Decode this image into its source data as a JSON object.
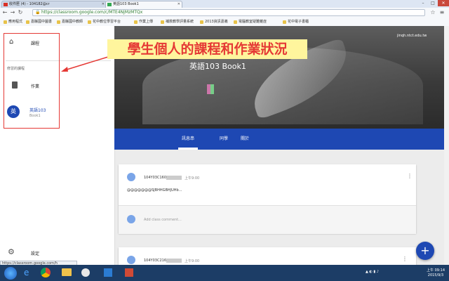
{
  "browser": {
    "tabs": [
      {
        "label": "收件匣 (4) - 104182@cr"
      },
      {
        "label": "英語103 Book1"
      }
    ],
    "url": "https://classroom.google.com/c/MTE4NjMzMTQx",
    "bookmarks": [
      "應用程式",
      "嘉縣國中圖書",
      "嘉縣國中教師",
      "花中教位學習平台",
      "作業上傳",
      "補救教學評量系統",
      "2013資訊嘉義",
      "電腦教室疑難雜症",
      "花中電子書櫃"
    ],
    "status_url": "https://classroom.google.com/h"
  },
  "sidebar": {
    "classes_label": "課程",
    "section_label": "修習的課程",
    "todo_label": "作業",
    "course": {
      "avatar": "英",
      "name": "英語103",
      "section": "Book1"
    },
    "settings_label": "設定"
  },
  "account": {
    "email": "jinqh.ntct.edu.tw"
  },
  "banner": {
    "title": "英語103 Book1"
  },
  "course_tabs": [
    "訊息串",
    "同學",
    "關於"
  ],
  "annotation": "學生個人的課程和作業狀況",
  "posts": [
    {
      "author": "104Y03C160",
      "time": "上午9:00",
      "body": "@@@@@@@SJBHHGBHJUHb...",
      "comment_placeholder": "Add class comment..."
    },
    {
      "author": "104Y03C216",
      "time": "上午9:00"
    }
  ],
  "fab": "+",
  "clock": {
    "time": "上午 09:14",
    "date": "2015/9/3"
  },
  "colors": {
    "accent": "#1e48b3",
    "annotation_text": "#e53935",
    "annotation_bg": "#fff59d"
  }
}
